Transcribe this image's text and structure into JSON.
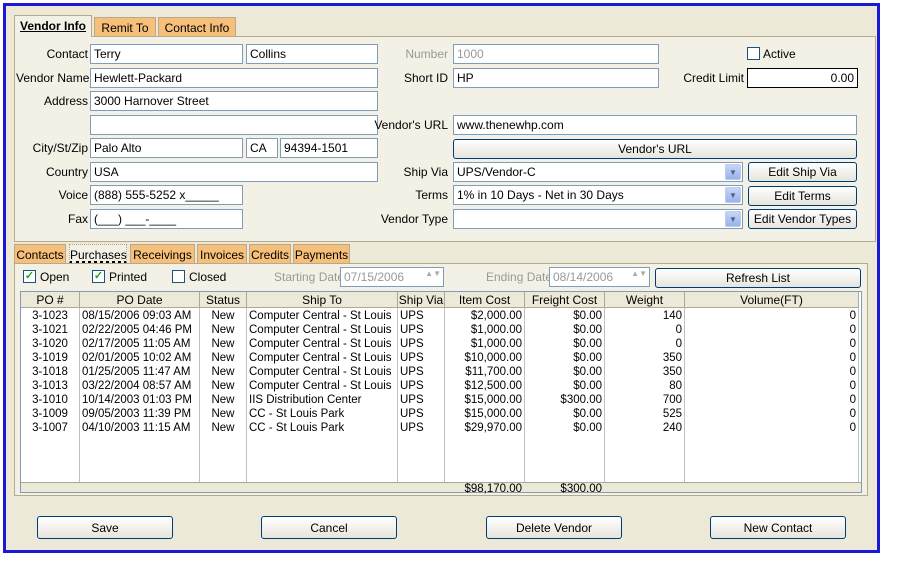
{
  "top_tabs": [
    {
      "label": "Vendor Info"
    },
    {
      "label": "Remit To"
    },
    {
      "label": "Contact Info"
    }
  ],
  "form": {
    "contact_label": "Contact",
    "contact_first": "Terry",
    "contact_last": "Collins",
    "vendor_name_label": "Vendor Name",
    "vendor_name": "Hewlett-Packard",
    "address_label": "Address",
    "address1": "3000 Harnover Street",
    "address2": "",
    "city_label": "City/St/Zip",
    "city": "Palo Alto",
    "state": "CA",
    "zip": "94394-1501",
    "country_label": "Country",
    "country": "USA",
    "voice_label": "Voice",
    "voice": "(888) 555-5252 x_____",
    "fax_label": "Fax",
    "fax": "(___) ___-____",
    "number_label": "Number",
    "number": "1000",
    "short_id_label": "Short ID",
    "short_id": "HP",
    "active_label": "Active",
    "active": false,
    "credit_limit_label": "Credit Limit",
    "credit_limit": "0.00",
    "url_label": "Vendor's URL",
    "url": "www.thenewhp.com",
    "url_button": "Vendor's URL",
    "ship_via_label": "Ship Via",
    "ship_via": "UPS/Vendor-C",
    "edit_ship_via": "Edit Ship Via",
    "terms_label": "Terms",
    "terms": "1% in 10 Days - Net in 30 Days",
    "edit_terms": "Edit Terms",
    "vendor_type_label": "Vendor Type",
    "vendor_type": "",
    "edit_vendor_types": "Edit Vendor Types"
  },
  "sub_tabs": [
    {
      "label": "Contacts"
    },
    {
      "label": "Purchases"
    },
    {
      "label": "Receivings"
    },
    {
      "label": "Invoices"
    },
    {
      "label": "Credits"
    },
    {
      "label": "Payments"
    }
  ],
  "filters": {
    "open_label": "Open",
    "open": true,
    "printed_label": "Printed",
    "printed": true,
    "closed_label": "Closed",
    "closed": false,
    "starting_date_label": "Starting Date",
    "starting_date": "07/15/2006",
    "ending_date_label": "Ending Date",
    "ending_date": "08/14/2006",
    "refresh_label": "Refresh List"
  },
  "table": {
    "columns": [
      "PO #",
      "PO Date",
      "Status",
      "Ship To",
      "Ship Via",
      "Item Cost",
      "Freight Cost",
      "Weight",
      "Volume(FT)"
    ],
    "rows": [
      [
        "3-1023",
        "08/15/2006 09:03 AM",
        "New",
        "Computer Central - St Louis Pa",
        "UPS",
        "$2,000.00",
        "$0.00",
        "140",
        "0"
      ],
      [
        "3-1021",
        "02/22/2005 04:46 PM",
        "New",
        "Computer Central - St Louis Pa",
        "UPS",
        "$1,000.00",
        "$0.00",
        "0",
        "0"
      ],
      [
        "3-1020",
        "02/17/2005 11:05 AM",
        "New",
        "Computer Central - St Louis Pa",
        "UPS",
        "$1,000.00",
        "$0.00",
        "0",
        "0"
      ],
      [
        "3-1019",
        "02/01/2005 10:02 AM",
        "New",
        "Computer Central - St Louis Pa",
        "UPS",
        "$10,000.00",
        "$0.00",
        "350",
        "0"
      ],
      [
        "3-1018",
        "01/25/2005 11:47 AM",
        "New",
        "Computer Central - St Louis Pa",
        "UPS",
        "$11,700.00",
        "$0.00",
        "350",
        "0"
      ],
      [
        "3-1013",
        "03/22/2004 08:57 AM",
        "New",
        "Computer Central - St Louis Pa",
        "UPS",
        "$12,500.00",
        "$0.00",
        "80",
        "0"
      ],
      [
        "3-1010",
        "10/14/2003 01:03 PM",
        "New",
        "IIS Distribution Center",
        "UPS",
        "$15,000.00",
        "$300.00",
        "700",
        "0"
      ],
      [
        "3-1009",
        "09/05/2003 11:39 PM",
        "New",
        "CC - St Louis Park",
        "UPS",
        "$15,000.00",
        "$0.00",
        "525",
        "0"
      ],
      [
        "3-1007",
        "04/10/2003 11:15 AM",
        "New",
        "CC - St Louis Park",
        "UPS",
        "$29,970.00",
        "$0.00",
        "240",
        "0"
      ]
    ],
    "total_item_cost": "$98,170.00",
    "total_freight_cost": "$300.00"
  },
  "buttons": {
    "save": "Save",
    "cancel": "Cancel",
    "delete": "Delete Vendor",
    "new_contact": "New Contact"
  }
}
